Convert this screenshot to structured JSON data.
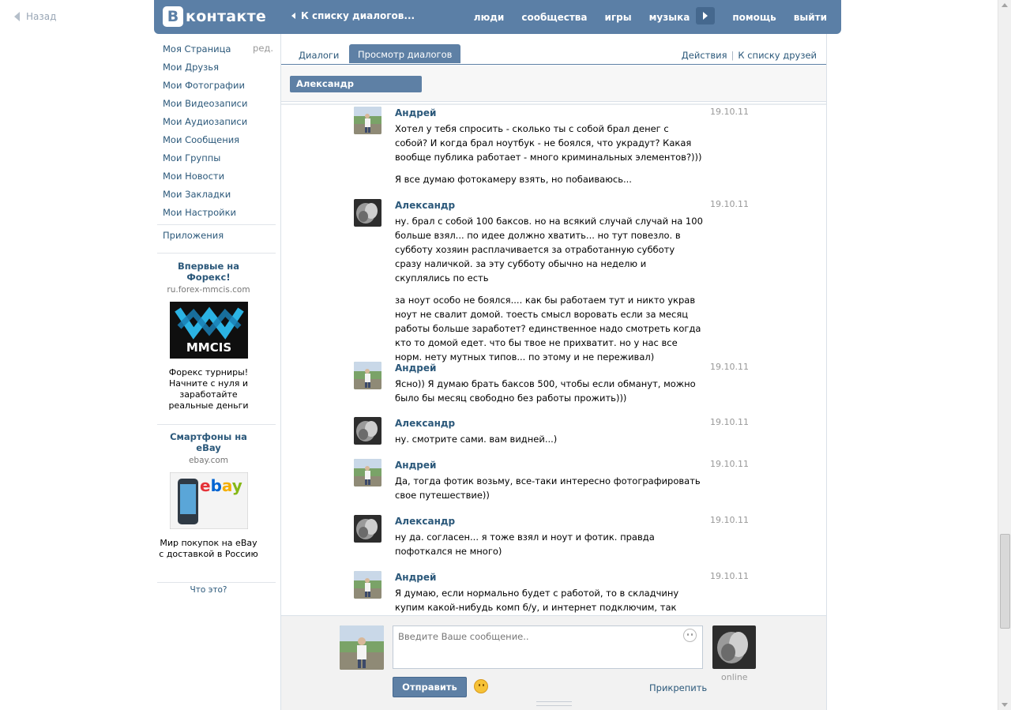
{
  "back_label": "Назад",
  "header": {
    "logo_letter": "В",
    "logo_text": "контакте",
    "back_to_list": "К списку диалогов...",
    "nav": [
      "люди",
      "сообщества",
      "игры",
      "музыка",
      "помощь",
      "выйти"
    ]
  },
  "menu": {
    "items": [
      "Моя Страница",
      "Мои Друзья",
      "Мои Фотографии",
      "Мои Видеозаписи",
      "Мои Аудиозаписи",
      "Мои Сообщения",
      "Мои Группы",
      "Мои Новости",
      "Мои Закладки",
      "Мои Настройки"
    ],
    "edit": "ред.",
    "apps": "Приложения"
  },
  "ads": [
    {
      "title": "Впервые на Форекс!",
      "domain": "ru.forex-mmcis.com",
      "logo_text": "MMCIS",
      "text": "Форекс турниры! Начните с нуля и заработайте реальные деньги"
    },
    {
      "title": "Смартфоны на eBay",
      "domain": "ebay.com",
      "logo_text": "ebay",
      "text": "Мир покупок на eBay с доставкой в Россию"
    }
  ],
  "ads_what": "Что это?",
  "tabs": {
    "dialogs": "Диалоги",
    "view": "Просмотр диалогов",
    "actions": "Действия",
    "to_friends": "К списку друзей",
    "separator": "|"
  },
  "chip": "Александр",
  "messages": [
    {
      "name": "Андрей",
      "date": "19.10.11",
      "parts": [
        "Хотел у тебя спросить - сколько ты с собой брал денег с собой? И когда брал ноутбук - не боялся, что украдут? Какая вообще публика работает - много криминальных элементов?)))",
        "Я все думаю фотокамеру взять, но побаиваюсь..."
      ]
    },
    {
      "name": "Александр",
      "date": "19.10.11",
      "parts": [
        "ну. брал с собой 100 баксов. но на всякий случай случай на 100 больше взял... по идее должно хватить... но тут повезло. в субботу хозяин расплачивается за отработанную субботу сразу наличкой. за эту субботу обычно на неделю и скуплялись по есть",
        "за ноут особо не боялся.... как бы работаем тут и никто украв ноут не свалит домой. тоесть смысл воровать если за месяц работы больше заработет? единственное надо смотреть когда кто то домой едет. что бы твое не прихватит. но у нас все норм. нету мутных типов... по этому и не переживал)"
      ]
    },
    {
      "name": "Андрей",
      "date": "19.10.11",
      "parts": [
        "Ясно)) Я думаю брать баксов 500, чтобы если обманут, можно было бы месяц свободно без работы прожить)))"
      ]
    },
    {
      "name": "Александр",
      "date": "19.10.11",
      "parts": [
        "ну. смотрите сами. вам видней...)"
      ]
    },
    {
      "name": "Андрей",
      "date": "19.10.11",
      "parts": [
        "Да, тогда фотик возьму, все-таки интересно фотографировать свое путешествие))"
      ]
    },
    {
      "name": "Александр",
      "date": "19.10.11",
      "parts": [
        "ну да. согласен... я тоже взял и ноут и фотик. правда пофоткался не много)"
      ]
    },
    {
      "name": "Андрей",
      "date": "19.10.11",
      "parts": [
        "Я думаю, если нормально будет с работой, то в складчину купим какой-нибудь комп б/у, и интернет подключим, так будем и"
      ]
    }
  ],
  "compose": {
    "placeholder": "Введите Ваше сообщение..",
    "send": "Отправить",
    "attach": "Прикрепить",
    "online": "online"
  }
}
